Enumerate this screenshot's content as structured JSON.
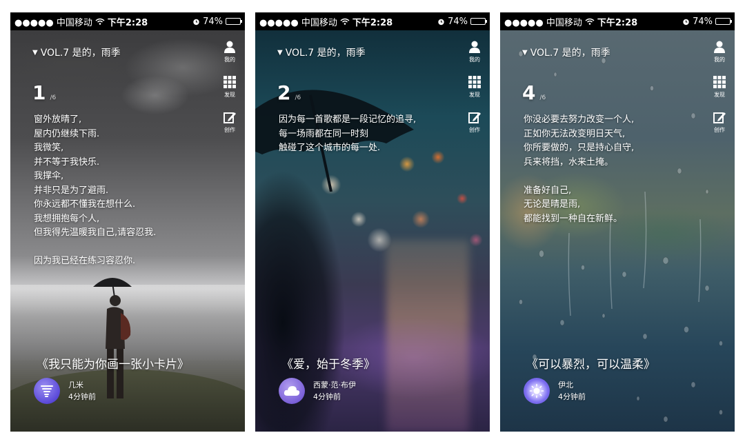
{
  "status_bar": {
    "carrier": "●●●●● 中国移动",
    "time": "下午2:28",
    "battery_text": "74%",
    "battery_level": 0.74,
    "battery_color": "#f2c200"
  },
  "header": {
    "volume_title": "VOL.7 是的，雨季"
  },
  "side_menu": [
    {
      "label": "我的",
      "icon": "person-icon"
    },
    {
      "label": "发现",
      "icon": "grid-icon"
    },
    {
      "label": "创作",
      "icon": "edit-icon"
    }
  ],
  "cards": [
    {
      "page_number": "1",
      "page_total": "/6",
      "poem_lines": [
        "窗外放晴了,",
        "屋内仍继续下雨.",
        "我微笑,",
        "并不等于我快乐.",
        "我撑伞,",
        "并非只是为了避雨.",
        "你永远都不懂我在想什么.",
        "我想拥抱每个人,",
        "但我得先温暖我自己,请容忍我.",
        "",
        "因为我已经在练习容忍你."
      ],
      "song_title": "《我只能为你画一张小卡片》",
      "author_name": "几米",
      "time_ago": "4分钟前",
      "avatar_icon": "tornado-icon"
    },
    {
      "page_number": "2",
      "page_total": "/6",
      "poem_lines": [
        "因为每一首歌都是一段记忆的追寻,",
        "每一场雨都在同一时刻",
        "触碰了这个城市的每一处."
      ],
      "song_title": "《爱，始于冬季》",
      "author_name": "西蒙·范·布伊",
      "time_ago": "4分钟前",
      "avatar_icon": "cloud-icon"
    },
    {
      "page_number": "4",
      "page_total": "/6",
      "poem_lines": [
        "你没必要去努力改变一个人,",
        "正如你无法改变明日天气,",
        "你所要做的，只是持心自守,",
        "兵来将挡，水来土掩。",
        "",
        "准备好自己,",
        "无论是晴是雨,",
        "都能找到一种自在新鲜。"
      ],
      "song_title": "《可以暴烈，可以温柔》",
      "author_name": "伊北",
      "time_ago": "4分钟前",
      "avatar_icon": "sun-icon"
    }
  ]
}
